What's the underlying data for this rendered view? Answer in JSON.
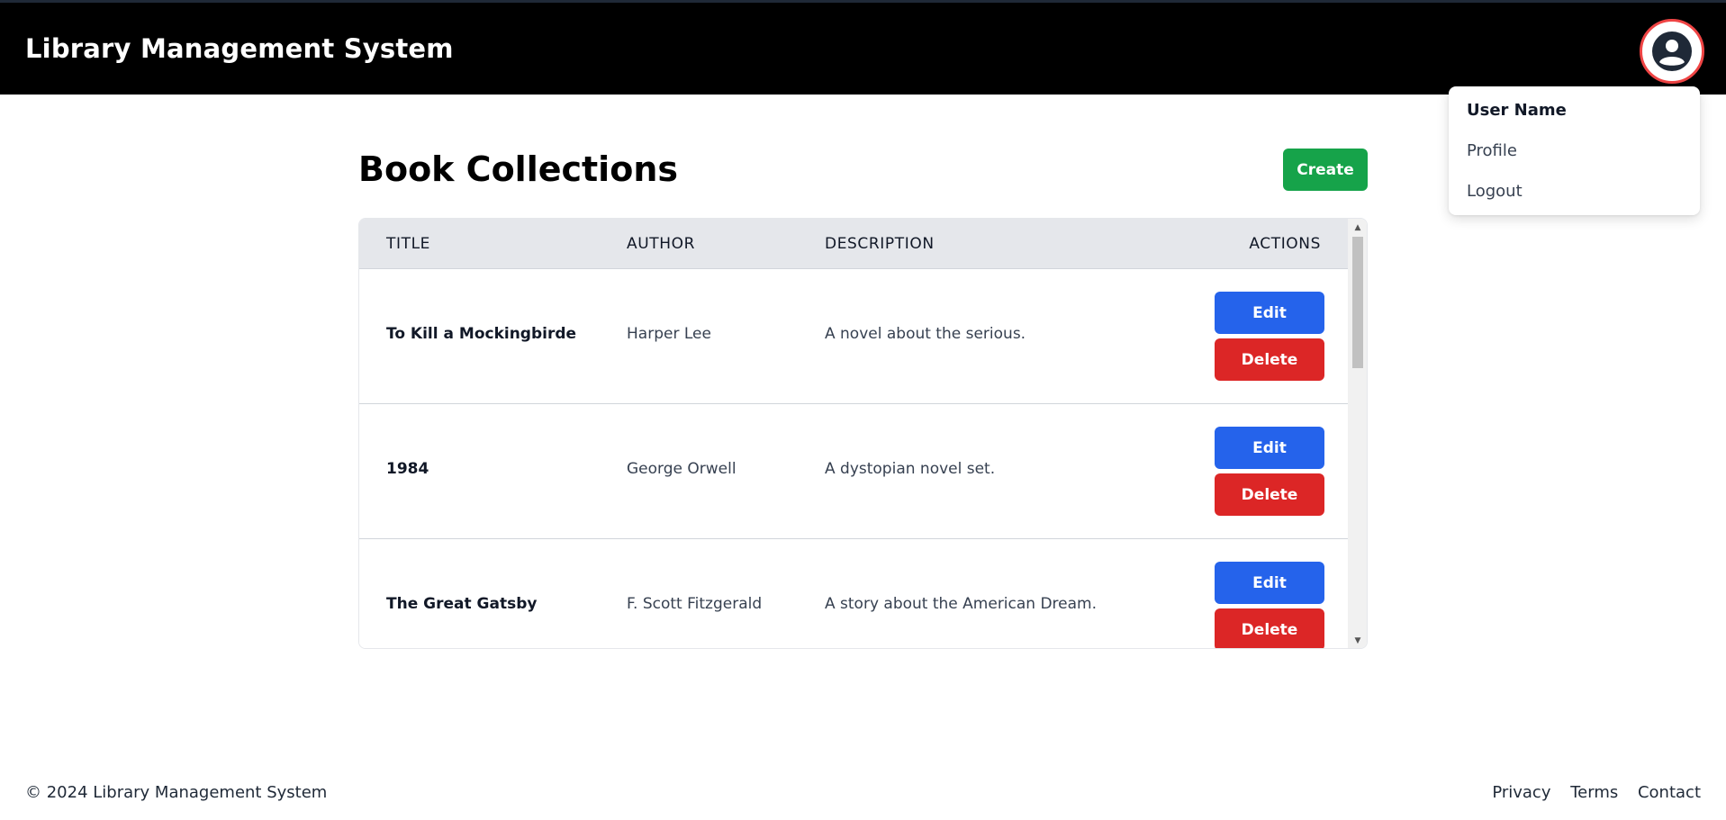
{
  "header": {
    "title": "Library Management System",
    "avatar_icon": "user-circle-icon"
  },
  "user_menu": {
    "user_name": "User Name",
    "items": [
      "Profile",
      "Logout"
    ]
  },
  "main": {
    "heading": "Book Collections",
    "create_label": "Create"
  },
  "table": {
    "columns": [
      "TITLE",
      "AUTHOR",
      "DESCRIPTION",
      "ACTIONS"
    ],
    "rows": [
      {
        "title": "To Kill a Mockingbirde",
        "author": "Harper Lee",
        "description": "A novel about the serious."
      },
      {
        "title": "1984",
        "author": "George Orwell",
        "description": "A dystopian novel set."
      },
      {
        "title": "The Great Gatsby",
        "author": "F. Scott Fitzgerald",
        "description": "A story about the American Dream."
      }
    ],
    "edit_label": "Edit",
    "delete_label": "Delete"
  },
  "footer": {
    "copyright": "© 2024 Library Management System",
    "links": [
      "Privacy",
      "Terms",
      "Contact"
    ]
  },
  "colors": {
    "header_bg": "#000000",
    "create": "#16a34a",
    "edit": "#2563eb",
    "delete": "#dc2626",
    "avatar_ring": "#ef4444"
  }
}
